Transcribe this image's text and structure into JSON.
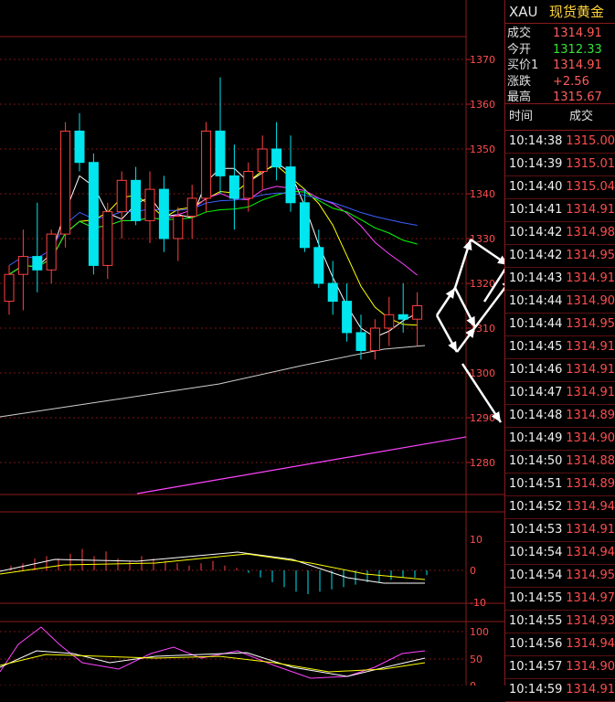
{
  "header": {
    "symbol": "XAU",
    "name": "现货黄金"
  },
  "quote": [
    {
      "key": "成交",
      "value": "1314.91",
      "color": "#ff5b5b"
    },
    {
      "key": "今开",
      "value": "1312.33",
      "color": "#36e336"
    },
    {
      "key": "买价1",
      "value": "1314.91",
      "color": "#ff5b5b"
    },
    {
      "key": "涨跌",
      "value": "+2.56",
      "color": "#ff5b5b"
    },
    {
      "key": "最高",
      "value": "1315.67",
      "color": "#ff5b5b"
    }
  ],
  "ticks_header": {
    "time": "时间",
    "price": "成交"
  },
  "ticks": [
    {
      "time": "10:14:38",
      "price": "1315.00"
    },
    {
      "time": "10:14:39",
      "price": "1315.01"
    },
    {
      "time": "10:14:40",
      "price": "1315.04"
    },
    {
      "time": "10:14:41",
      "price": "1314.91"
    },
    {
      "time": "10:14:42",
      "price": "1314.98"
    },
    {
      "time": "10:14:42",
      "price": "1314.95"
    },
    {
      "time": "10:14:43",
      "price": "1314.91"
    },
    {
      "time": "10:14:44",
      "price": "1314.90"
    },
    {
      "time": "10:14:44",
      "price": "1314.95"
    },
    {
      "time": "10:14:45",
      "price": "1314.91"
    },
    {
      "time": "10:14:46",
      "price": "1314.91"
    },
    {
      "time": "10:14:47",
      "price": "1314.91"
    },
    {
      "time": "10:14:48",
      "price": "1314.89"
    },
    {
      "time": "10:14:49",
      "price": "1314.90"
    },
    {
      "time": "10:14:50",
      "price": "1314.88"
    },
    {
      "time": "10:14:51",
      "price": "1314.89"
    },
    {
      "time": "10:14:52",
      "price": "1314.94"
    },
    {
      "time": "10:14:53",
      "price": "1314.91"
    },
    {
      "time": "10:14:54",
      "price": "1314.94"
    },
    {
      "time": "10:14:54",
      "price": "1314.95"
    },
    {
      "time": "10:14:55",
      "price": "1314.97"
    },
    {
      "time": "10:14:55",
      "price": "1314.93"
    },
    {
      "time": "10:14:56",
      "price": "1314.94"
    },
    {
      "time": "10:14:57",
      "price": "1314.90"
    },
    {
      "time": "10:14:59",
      "price": "1314.91"
    }
  ],
  "chart_data": {
    "type": "candlestick",
    "price_axis_ticks": [
      "1370",
      "1360",
      "1350",
      "1340",
      "1330",
      "1320",
      "1310",
      "1300",
      "1290",
      "1280"
    ],
    "macd_axis_ticks": [
      "10",
      "0",
      "-10"
    ],
    "kdj_axis_ticks": [
      "100",
      "50",
      "0"
    ],
    "ylim": [
      1270,
      1375
    ],
    "colors": {
      "up": "#ff4040",
      "down": "#00e5ee",
      "ma5": "#ffffff",
      "ma10": "#ffff00",
      "ma20": "#ff44ff",
      "ma30": "#00ff00",
      "ma60": "#3a5fff",
      "ma250": "#cfcfcf",
      "long_line": "#ff44ff"
    },
    "candles": [
      {
        "o": 1316,
        "h": 1324,
        "l": 1313,
        "c": 1322
      },
      {
        "o": 1322,
        "h": 1332,
        "l": 1314,
        "c": 1326
      },
      {
        "o": 1326,
        "h": 1338,
        "l": 1318,
        "c": 1323
      },
      {
        "o": 1323,
        "h": 1332,
        "l": 1320,
        "c": 1331
      },
      {
        "o": 1331,
        "h": 1356,
        "l": 1328,
        "c": 1354
      },
      {
        "o": 1354,
        "h": 1358,
        "l": 1345,
        "c": 1347
      },
      {
        "o": 1347,
        "h": 1349,
        "l": 1322,
        "c": 1324
      },
      {
        "o": 1324,
        "h": 1338,
        "l": 1321,
        "c": 1336
      },
      {
        "o": 1336,
        "h": 1345,
        "l": 1330,
        "c": 1343
      },
      {
        "o": 1343,
        "h": 1346,
        "l": 1333,
        "c": 1334
      },
      {
        "o": 1334,
        "h": 1345,
        "l": 1329,
        "c": 1341
      },
      {
        "o": 1341,
        "h": 1344,
        "l": 1327,
        "c": 1330
      },
      {
        "o": 1330,
        "h": 1337,
        "l": 1325,
        "c": 1335
      },
      {
        "o": 1335,
        "h": 1342,
        "l": 1330,
        "c": 1339
      },
      {
        "o": 1339,
        "h": 1356,
        "l": 1336,
        "c": 1354
      },
      {
        "o": 1354,
        "h": 1366,
        "l": 1340,
        "c": 1344
      },
      {
        "o": 1344,
        "h": 1351,
        "l": 1332,
        "c": 1339
      },
      {
        "o": 1339,
        "h": 1347,
        "l": 1336,
        "c": 1345
      },
      {
        "o": 1345,
        "h": 1353,
        "l": 1341,
        "c": 1350
      },
      {
        "o": 1350,
        "h": 1356,
        "l": 1343,
        "c": 1346
      },
      {
        "o": 1346,
        "h": 1353,
        "l": 1336,
        "c": 1338
      },
      {
        "o": 1338,
        "h": 1341,
        "l": 1327,
        "c": 1328
      },
      {
        "o": 1328,
        "h": 1332,
        "l": 1319,
        "c": 1320
      },
      {
        "o": 1320,
        "h": 1325,
        "l": 1313,
        "c": 1316
      },
      {
        "o": 1316,
        "h": 1320,
        "l": 1307,
        "c": 1309
      },
      {
        "o": 1309,
        "h": 1313,
        "l": 1303,
        "c": 1305
      },
      {
        "o": 1305,
        "h": 1312,
        "l": 1303,
        "c": 1310
      },
      {
        "o": 1310,
        "h": 1317,
        "l": 1306,
        "c": 1313
      },
      {
        "o": 1313,
        "h": 1320,
        "l": 1309,
        "c": 1312
      },
      {
        "o": 1312,
        "h": 1318,
        "l": 1306,
        "c": 1315
      }
    ]
  }
}
